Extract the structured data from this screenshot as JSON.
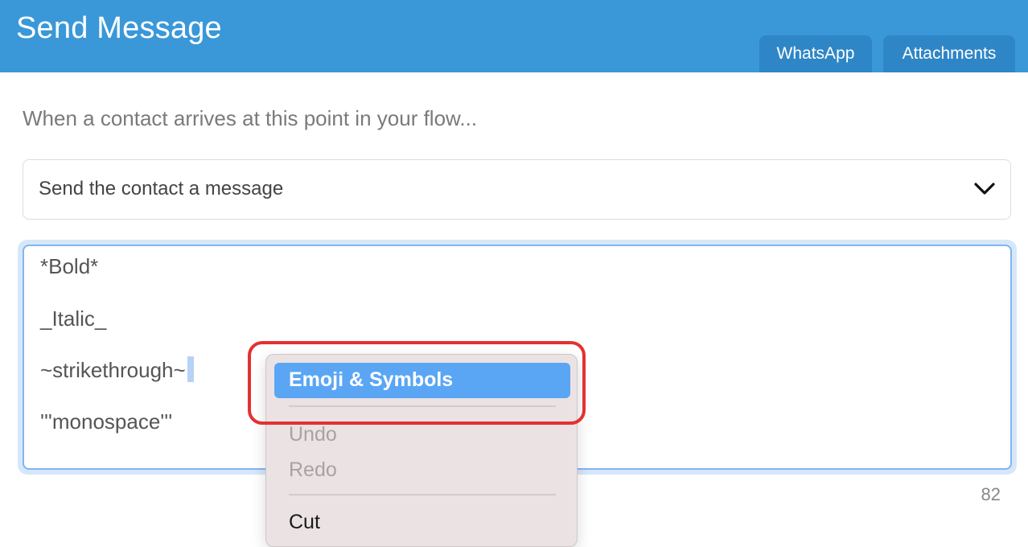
{
  "header": {
    "title": "Send Message",
    "tabs": [
      {
        "label": "WhatsApp"
      },
      {
        "label": "Attachments"
      }
    ]
  },
  "intro_text": "When a contact arrives at this point in your flow...",
  "action_select": {
    "value": "Send the contact a message"
  },
  "editor": {
    "lines": [
      "*Bold*",
      "_Italic_",
      "~strikethrough~",
      "'''monospace'''"
    ],
    "char_count": "82"
  },
  "context_menu": {
    "items": [
      {
        "label": "Emoji & Symbols",
        "highlighted": true
      },
      {
        "label": "Undo",
        "disabled": true
      },
      {
        "label": "Redo",
        "disabled": true
      },
      {
        "label": "Cut"
      }
    ]
  },
  "colors": {
    "header_bg": "#3a98d8",
    "tab_bg": "#2f86c6",
    "highlight": "#5aa6f4",
    "annotation": "#e53030"
  }
}
